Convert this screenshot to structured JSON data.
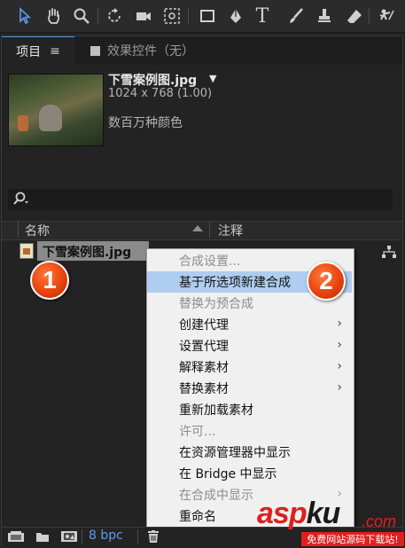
{
  "toolbar": {
    "tools": [
      "selection-tool",
      "hand-tool",
      "zoom-tool",
      "rotate-tool",
      "camera-tool",
      "pan-behind-tool",
      "rectangle-tool",
      "pen-tool",
      "type-tool",
      "brush-tool",
      "clone-stamp-tool",
      "eraser-tool",
      "puppet-tool"
    ],
    "type_tool_glyph": "T"
  },
  "tabs": {
    "project": "项目",
    "project_menu": "≡",
    "effects": "效果控件（无）"
  },
  "asset": {
    "name": "下雪案例图.jpg",
    "dims": "1024 x 768 (1.00)",
    "colors": "数百万种颜色"
  },
  "search": {
    "icon": "search-icon"
  },
  "columns": {
    "name": "名称",
    "comment": "注释"
  },
  "file": {
    "name": "下雪案例图.jpg"
  },
  "context_menu": {
    "items": [
      {
        "label": "合成设置...",
        "disabled": true,
        "submenu": false,
        "selected": false
      },
      {
        "label": "基于所选项新建合成",
        "disabled": false,
        "submenu": false,
        "selected": true
      },
      {
        "label": "替换为预合成",
        "disabled": true,
        "submenu": false,
        "selected": false
      },
      {
        "label": "创建代理",
        "disabled": false,
        "submenu": true,
        "selected": false
      },
      {
        "label": "设置代理",
        "disabled": false,
        "submenu": true,
        "selected": false
      },
      {
        "label": "解释素材",
        "disabled": false,
        "submenu": true,
        "selected": false
      },
      {
        "label": "替换素材",
        "disabled": false,
        "submenu": true,
        "selected": false
      },
      {
        "label": "重新加载素材",
        "disabled": false,
        "submenu": false,
        "selected": false
      },
      {
        "label": "许可...",
        "disabled": true,
        "submenu": false,
        "selected": false
      },
      {
        "label": "在资源管理器中显示",
        "disabled": false,
        "submenu": false,
        "selected": false
      },
      {
        "label": "在 Bridge 中显示",
        "disabled": false,
        "submenu": false,
        "selected": false
      },
      {
        "label": "在合成中显示",
        "disabled": true,
        "submenu": true,
        "selected": false
      },
      {
        "label": "重命名",
        "disabled": false,
        "submenu": false,
        "selected": false
      }
    ],
    "chevron": "›"
  },
  "badges": {
    "one": "1",
    "two": "2"
  },
  "bottom": {
    "bpc": "8 bpc"
  },
  "watermark": {
    "logo_a": "asp",
    "logo_b": "ku",
    "com": ".com",
    "tagline": "免费网站源码下载站!"
  },
  "colors": {
    "accent": "#5b9cf0",
    "menu_highlight": "#aecdf0",
    "badge": "#e8430f",
    "watermark_red": "#e01f1f"
  }
}
